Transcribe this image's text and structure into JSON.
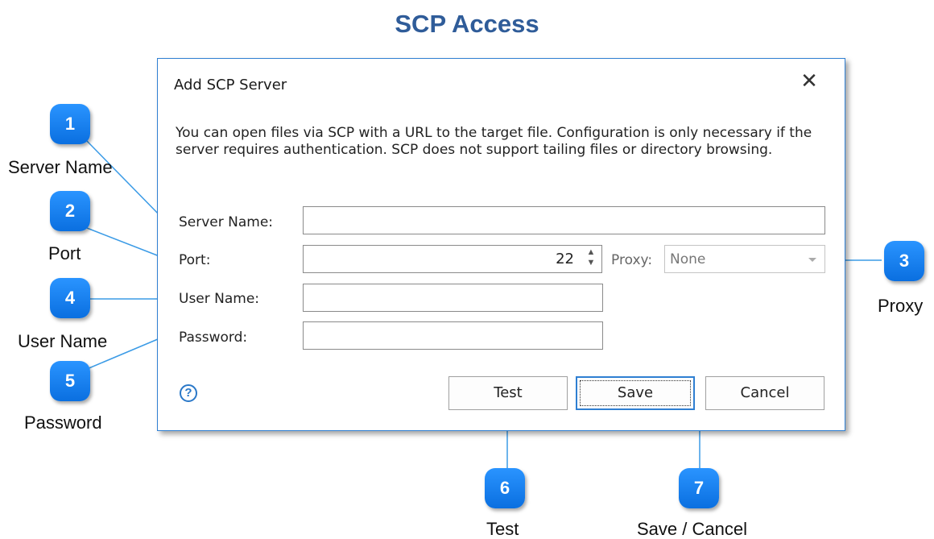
{
  "page": {
    "title": "SCP Access"
  },
  "dialog": {
    "title": "Add SCP Server",
    "close_glyph": "✕",
    "description": "You can open files via SCP with a URL to the target file.  Configuration is only necessary if the server requires authentication.  SCP does not support tailing files or directory browsing.",
    "fields": {
      "server_name": {
        "label": "Server Name:",
        "value": ""
      },
      "port": {
        "label": "Port:",
        "value": "22"
      },
      "proxy": {
        "label": "Proxy:",
        "value": "None"
      },
      "user_name": {
        "label": "User Name:",
        "value": ""
      },
      "password": {
        "label": "Password:",
        "value": ""
      }
    },
    "help_glyph": "?",
    "buttons": {
      "test": "Test",
      "save": "Save",
      "cancel": "Cancel"
    }
  },
  "callouts": [
    {
      "number": "1",
      "label": "Server Name"
    },
    {
      "number": "2",
      "label": "Port"
    },
    {
      "number": "3",
      "label": "Proxy"
    },
    {
      "number": "4",
      "label": "User Name"
    },
    {
      "number": "5",
      "label": "Password"
    },
    {
      "number": "6",
      "label": "Test"
    },
    {
      "number": "7",
      "label": "Save / Cancel"
    }
  ],
  "colors": {
    "accent": "#2f7fd2",
    "title": "#2f5c99",
    "badge": "#1a82f7"
  }
}
